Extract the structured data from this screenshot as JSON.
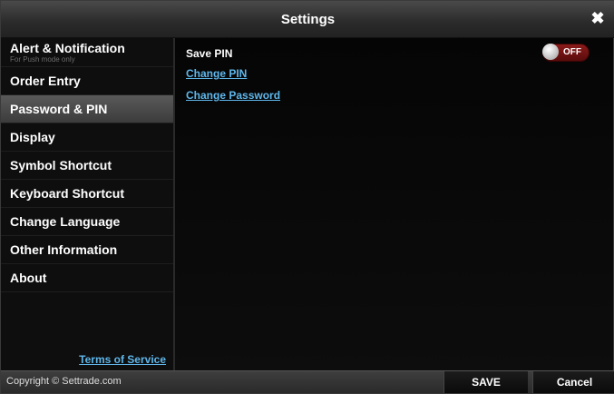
{
  "window": {
    "title": "Settings",
    "close_icon": "✖"
  },
  "sidebar": {
    "items": [
      {
        "label": "Alert & Notification",
        "sub": "For Push mode only",
        "active": false
      },
      {
        "label": "Order Entry",
        "active": false
      },
      {
        "label": "Password & PIN",
        "active": true
      },
      {
        "label": "Display",
        "active": false
      },
      {
        "label": "Symbol Shortcut",
        "active": false
      },
      {
        "label": "Keyboard Shortcut",
        "active": false
      },
      {
        "label": "Change Language",
        "active": false
      },
      {
        "label": "Other Information",
        "active": false
      },
      {
        "label": "About",
        "active": false
      }
    ],
    "terms_link": "Terms of Service"
  },
  "content": {
    "save_pin_label": "Save PIN",
    "save_pin_toggle": "OFF",
    "change_pin_link": "Change PIN",
    "change_password_link": "Change Password"
  },
  "footer": {
    "copyright": "Copyright © Settrade.com",
    "save_label": "SAVE",
    "cancel_label": "Cancel"
  },
  "colors": {
    "link": "#5fb6ea",
    "toggle_off": "#8a1a1a",
    "active_item": "#4a4a4a"
  }
}
